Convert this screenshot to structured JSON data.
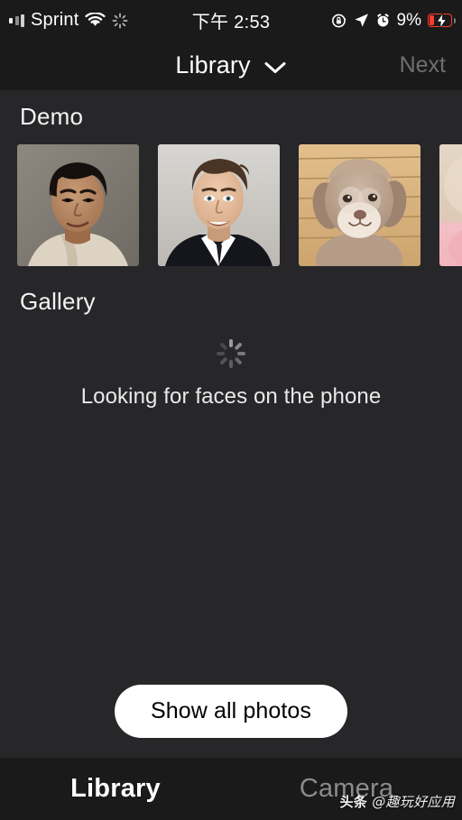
{
  "status_bar": {
    "carrier": "Sprint",
    "time": "下午 2:53",
    "battery_percent": "9%",
    "icons": {
      "signal": "signal-bars-icon",
      "wifi": "wifi-icon",
      "sync": "sync-spinner-icon",
      "rotation_lock": "rotation-lock-icon",
      "location": "location-arrow-icon",
      "alarm": "alarm-clock-icon",
      "battery": "battery-charging-icon"
    },
    "battery_color": "#ff3b30"
  },
  "nav": {
    "title": "Library",
    "chevron": "chevron-down-icon",
    "next_label": "Next",
    "next_enabled": false
  },
  "sections": {
    "demo": {
      "title": "Demo",
      "thumbnails": [
        {
          "name": "Jackie Chan portrait"
        },
        {
          "name": "Elon Musk portrait"
        },
        {
          "name": "Fluffy dog on wooden deck"
        },
        {
          "name": "Partially visible photo"
        }
      ]
    },
    "gallery": {
      "title": "Gallery",
      "spinner": "activity-indicator-icon",
      "status_text": "Looking for faces on the phone"
    }
  },
  "show_all_button": {
    "label": "Show all photos",
    "bg": "#ffffff",
    "fg": "#000000"
  },
  "tabbar": {
    "tabs": [
      {
        "label": "Library",
        "active": true
      },
      {
        "label": "Camera",
        "active": false
      }
    ]
  },
  "watermark": {
    "brand": "头条",
    "handle": "@趣玩好应用"
  },
  "colors": {
    "chrome_bg": "#1a1a1a",
    "content_bg": "#27272a",
    "text_primary": "#ffffff",
    "text_muted": "#8b8b8d"
  }
}
